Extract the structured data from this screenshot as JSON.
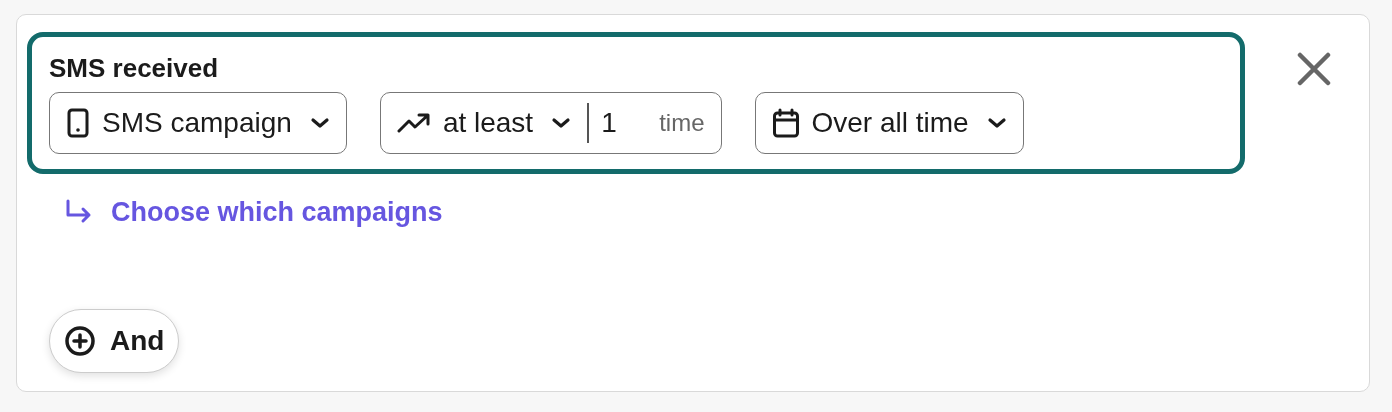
{
  "condition": {
    "title": "SMS received",
    "filters": [
      {
        "kind": "select",
        "label": "SMS campaign"
      },
      {
        "kind": "count",
        "label": "at least",
        "value": "1",
        "unit": "time"
      },
      {
        "kind": "select",
        "label": "Over all time"
      }
    ],
    "link": "Choose which campaigns"
  },
  "add_button": "And"
}
